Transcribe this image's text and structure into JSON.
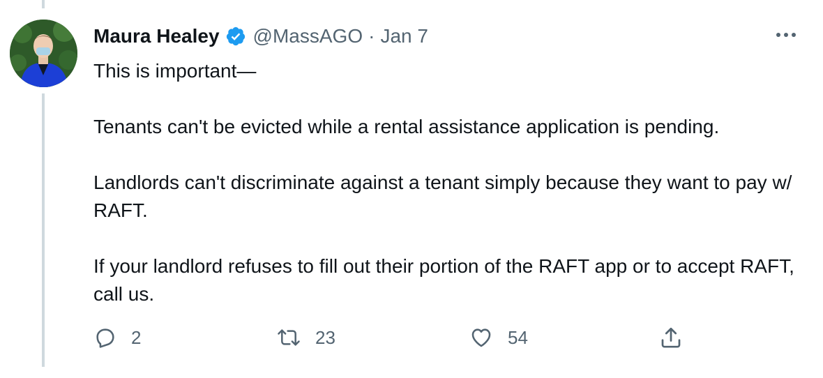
{
  "tweet": {
    "author": {
      "display_name": "Maura Healey",
      "handle": "@MassAGO",
      "verified": true,
      "avatar_icon": "profile-photo"
    },
    "separator": "·",
    "date": "Jan 7",
    "text": {
      "line1": "This is important—",
      "para2": "Tenants can't be evicted while a rental assistance application is pending.",
      "para3": "Landlords can't discriminate against a tenant simply because they want to pay w/ RAFT.",
      "para4": "If your landlord refuses to fill out their portion of the RAFT app or to accept RAFT, call us."
    },
    "actions": {
      "reply_count": "2",
      "retweet_count": "23",
      "like_count": "54"
    }
  },
  "colors": {
    "text_primary": "#0f1419",
    "text_secondary": "#536471",
    "verified_blue": "#1d9bf0",
    "thread_line": "#cfd9de"
  }
}
